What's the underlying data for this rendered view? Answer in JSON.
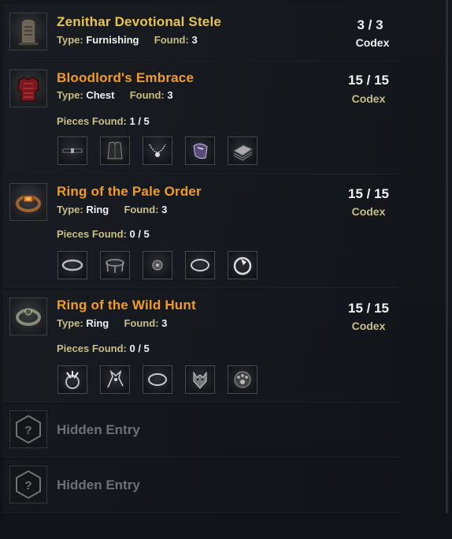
{
  "entries": [
    {
      "title": "Zenithar Devotional Stele",
      "type_key": "Type:",
      "type_value": "Furnishing",
      "found_key": "Found:",
      "found_value": "3",
      "count": "3 / 3",
      "codex": "Codex",
      "icon": "stele-icon"
    },
    {
      "title": "Bloodlord's Embrace",
      "type_key": "Type:",
      "type_value": "Chest",
      "found_key": "Found:",
      "found_value": "3",
      "count": "15 / 15",
      "codex": "Codex",
      "icon": "armor-chest-icon",
      "pieces_key": "Pieces Found:",
      "pieces_value": "1 / 5",
      "pieces": [
        "belt-icon",
        "vest-icon",
        "necklace-icon",
        "pauldron-icon",
        "folded-cloth-icon"
      ]
    },
    {
      "title": "Ring of the Pale Order",
      "type_key": "Type:",
      "type_value": "Ring",
      "found_key": "Found:",
      "found_value": "3",
      "count": "15 / 15",
      "codex": "Codex",
      "icon": "ring-gem-icon",
      "pieces_key": "Pieces Found:",
      "pieces_value": "0 / 5",
      "pieces": [
        "band-icon",
        "crown-frame-icon",
        "disc-icon",
        "ring-icon",
        "signet-ring-icon"
      ]
    },
    {
      "title": "Ring of the Wild Hunt",
      "type_key": "Type:",
      "type_value": "Ring",
      "found_key": "Found:",
      "found_value": "3",
      "count": "15 / 15",
      "codex": "Codex",
      "icon": "ring-dark-icon",
      "pieces_key": "Pieces Found:",
      "pieces_value": "0 / 5",
      "pieces": [
        "claw-ring-icon",
        "beast-skull-icon",
        "ring-icon",
        "wolf-head-icon",
        "paw-disc-icon"
      ]
    }
  ],
  "hidden_entries": [
    {
      "title": "Hidden Entry",
      "icon": "question-hex-icon"
    },
    {
      "title": "Hidden Entry",
      "icon": "question-hex-icon"
    }
  ],
  "colors": {
    "title_gold": "#e6c64c",
    "title_orange": "#f39c1f",
    "label_tan": "#c8bd85",
    "hidden_grey": "#6d6f73"
  }
}
